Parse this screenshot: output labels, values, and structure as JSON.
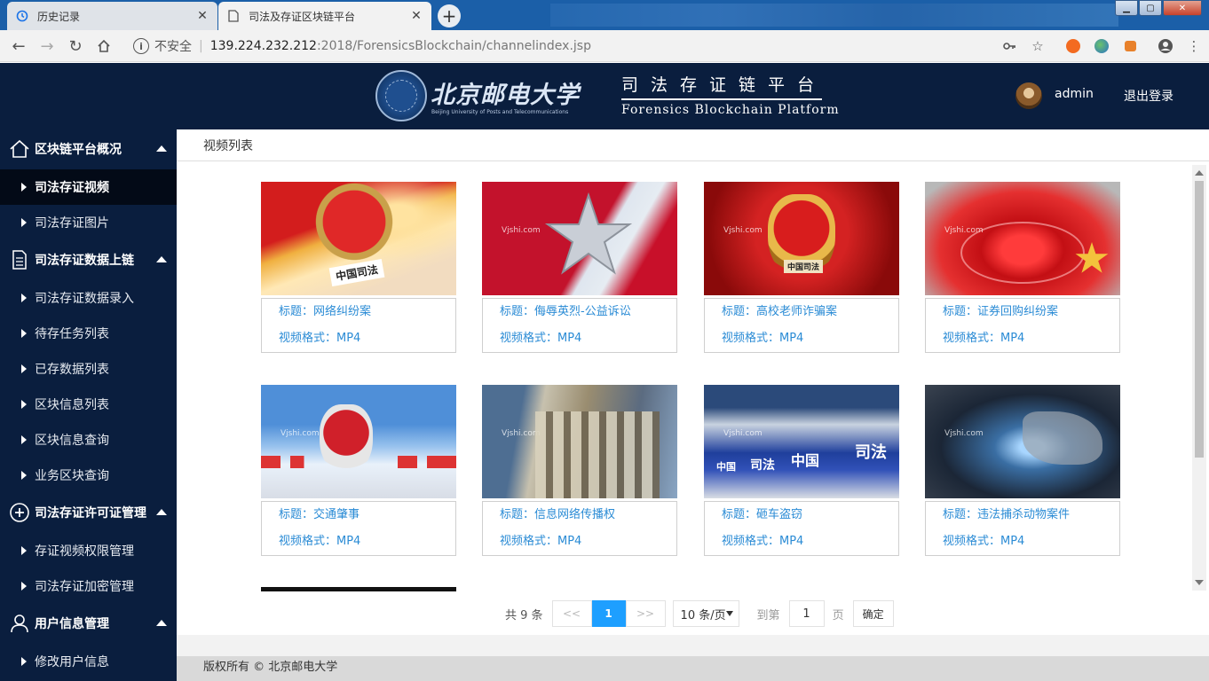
{
  "browser": {
    "tabs": [
      {
        "title": "历史记录",
        "icon": "history-icon"
      },
      {
        "title": "司法及存证区块链平台",
        "icon": "page-icon"
      }
    ],
    "address": {
      "security": "不安全",
      "host": "139.224.232.212",
      "path": ":2018/ForensicsBlockchain/channelindex.jsp"
    }
  },
  "header": {
    "logo_cn": "北京邮电大学",
    "logo_en": "Beijing University of Posts and Telecommunications",
    "title_cn": "司法存证链平台",
    "title_en": "Forensics Blockchain Platform",
    "username": "admin",
    "logout": "退出登录"
  },
  "sidebar": {
    "groups": [
      {
        "label": "区块链平台概况",
        "icon": "home-icon"
      },
      {
        "label": "司法存证数据上链",
        "icon": "document-icon"
      },
      {
        "label": "司法存证许可证管理",
        "icon": "plus-circle-icon"
      },
      {
        "label": "用户信息管理",
        "icon": "user-icon"
      }
    ],
    "items": [
      {
        "label": "司法存证视频"
      },
      {
        "label": "司法存证图片"
      },
      {
        "label": "司法存证数据录入"
      },
      {
        "label": "待存任务列表"
      },
      {
        "label": "已存数据列表"
      },
      {
        "label": "区块信息列表"
      },
      {
        "label": "区块信息查询"
      },
      {
        "label": "业务区块查询"
      },
      {
        "label": "存证视频权限管理"
      },
      {
        "label": "司法存证加密管理"
      },
      {
        "label": "修改用户信息"
      }
    ]
  },
  "main": {
    "breadcrumb": "视频列表",
    "watermark": "Vjshi.com",
    "videos": [
      {
        "title": "标题：网络纠纷案",
        "format": "视频格式：MP4"
      },
      {
        "title": "标题：侮辱英烈-公益诉讼",
        "format": "视频格式：MP4"
      },
      {
        "title": "标题：高校老师诈骗案",
        "format": "视频格式：MP4"
      },
      {
        "title": "标题：证券回购纠纷案",
        "format": "视频格式：MP4"
      },
      {
        "title": "标题：交通肇事",
        "format": "视频格式：MP4"
      },
      {
        "title": "标题：信息网络传播权",
        "format": "视频格式：MP4"
      },
      {
        "title": "标题：砸车盗窃",
        "format": "视频格式：MP4"
      },
      {
        "title": "标题：违法捕杀动物案件",
        "format": "视频格式：MP4"
      }
    ],
    "thumb_text": {
      "t1": "中国司法",
      "t3": "中国司法",
      "t7_left": "中国",
      "t7_mid": "司法",
      "t7_right": "中国",
      "t7_far": "司法"
    }
  },
  "pagination": {
    "total": "共 9 条",
    "prev": "<<",
    "current": "1",
    "next": ">>",
    "page_size": "10 条/页",
    "goto": "到第",
    "goto_value": "1",
    "page_suffix": "页",
    "confirm": "确定"
  },
  "footer": {
    "text": "版权所有 © 北京邮电大学"
  },
  "colors": {
    "nav_bg": "#0a1e3e",
    "link": "#2a8bd5",
    "accent": "#1e9fff"
  }
}
